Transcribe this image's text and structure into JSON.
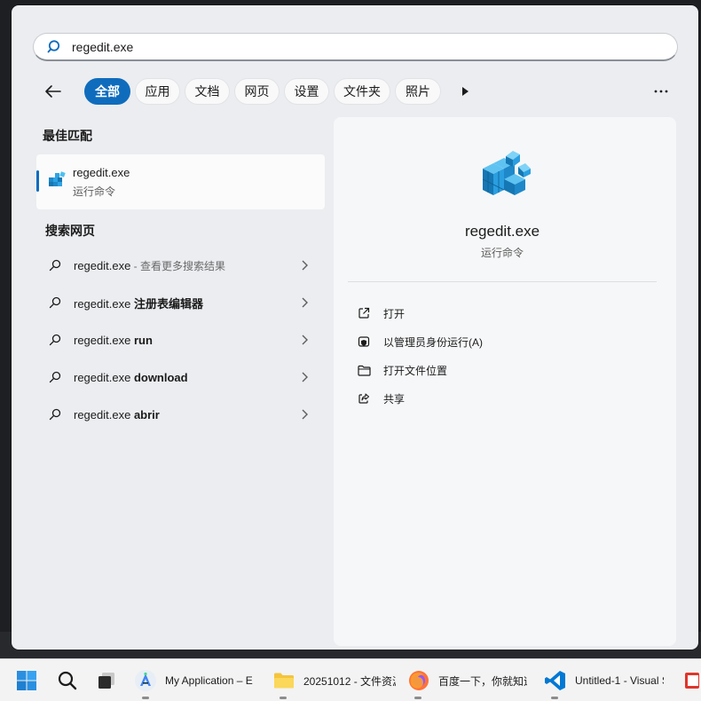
{
  "search": {
    "query": "regedit.exe"
  },
  "filters": {
    "items": [
      {
        "label": "全部",
        "active": true
      },
      {
        "label": "应用",
        "active": false
      },
      {
        "label": "文档",
        "active": false
      },
      {
        "label": "网页",
        "active": false
      },
      {
        "label": "设置",
        "active": false
      },
      {
        "label": "文件夹",
        "active": false
      },
      {
        "label": "照片",
        "active": false
      }
    ]
  },
  "best_match": {
    "heading": "最佳匹配",
    "name": "regedit.exe",
    "type": "运行命令"
  },
  "web": {
    "heading": "搜索网页",
    "items": [
      {
        "prefix": "regedit.exe",
        "suffix": " - 查看更多搜索结果",
        "suffix_style": "muted"
      },
      {
        "prefix": "regedit.exe ",
        "suffix": "注册表编辑器",
        "suffix_style": "bold"
      },
      {
        "prefix": "regedit.exe ",
        "suffix": "run",
        "suffix_style": "bold"
      },
      {
        "prefix": "regedit.exe ",
        "suffix": "download",
        "suffix_style": "bold"
      },
      {
        "prefix": "regedit.exe ",
        "suffix": "abrir",
        "suffix_style": "bold"
      }
    ]
  },
  "preview": {
    "title": "regedit.exe",
    "subtitle": "运行命令",
    "actions": [
      {
        "label": "打开",
        "icon": "open-external-icon"
      },
      {
        "label": "以管理员身份运行(A)",
        "icon": "admin-shield-icon"
      },
      {
        "label": "打开文件位置",
        "icon": "folder-icon"
      },
      {
        "label": "共享",
        "icon": "share-icon"
      }
    ]
  },
  "taskbar": {
    "items": [
      {
        "label": "",
        "icon": "windows-start-icon"
      },
      {
        "label": "",
        "icon": "search-icon"
      },
      {
        "label": "",
        "icon": "task-view-icon"
      },
      {
        "label": "My Application – E",
        "icon": "android-studio-icon"
      },
      {
        "label": "20251012 - 文件资源",
        "icon": "file-explorer-icon"
      },
      {
        "label": "百度一下，你就知道",
        "icon": "firefox-icon"
      },
      {
        "label": "Untitled-1 - Visual S",
        "icon": "vscode-icon"
      }
    ]
  },
  "colors": {
    "accent": "#0f6cbd",
    "panel": "#ebedf0",
    "preview": "#f6f7f8"
  }
}
